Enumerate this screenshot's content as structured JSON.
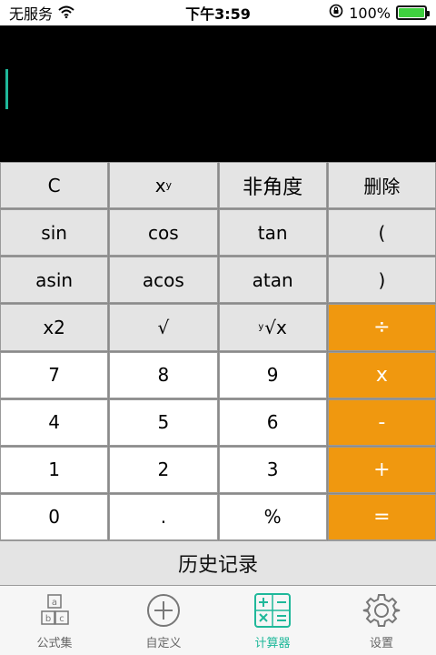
{
  "statusbar": {
    "carrier": "无服务",
    "time": "下午3:59",
    "battery_percent": "100%",
    "battery_level": 1.0
  },
  "keypad": {
    "row1": [
      "C",
      "x",
      "非角度",
      "删除"
    ],
    "row1_sup": "y",
    "row2": [
      "sin",
      "cos",
      "tan",
      "("
    ],
    "row3": [
      "asin",
      "acos",
      "atan",
      ")"
    ],
    "row4": [
      "x2",
      "√",
      "√x",
      "÷"
    ],
    "row4_root_sup": "y",
    "row5": [
      "7",
      "8",
      "9",
      "x"
    ],
    "row6": [
      "4",
      "5",
      "6",
      "-"
    ],
    "row7": [
      "1",
      "2",
      "3",
      "+"
    ],
    "row8": [
      "0",
      ".",
      "%",
      "="
    ]
  },
  "history_label": "历史记录",
  "tabs": [
    {
      "label": "公式集",
      "icon": "abc-blocks-icon"
    },
    {
      "label": "自定义",
      "icon": "plus-circle-icon"
    },
    {
      "label": "计算器",
      "icon": "calculator-icon",
      "active": true
    },
    {
      "label": "设置",
      "icon": "gear-icon"
    }
  ],
  "colors": {
    "accent": "#1fb89a",
    "operator": "#f0980f",
    "display_bg": "#000000",
    "function_key_bg": "#e4e4e4",
    "number_key_bg": "#ffffff"
  }
}
